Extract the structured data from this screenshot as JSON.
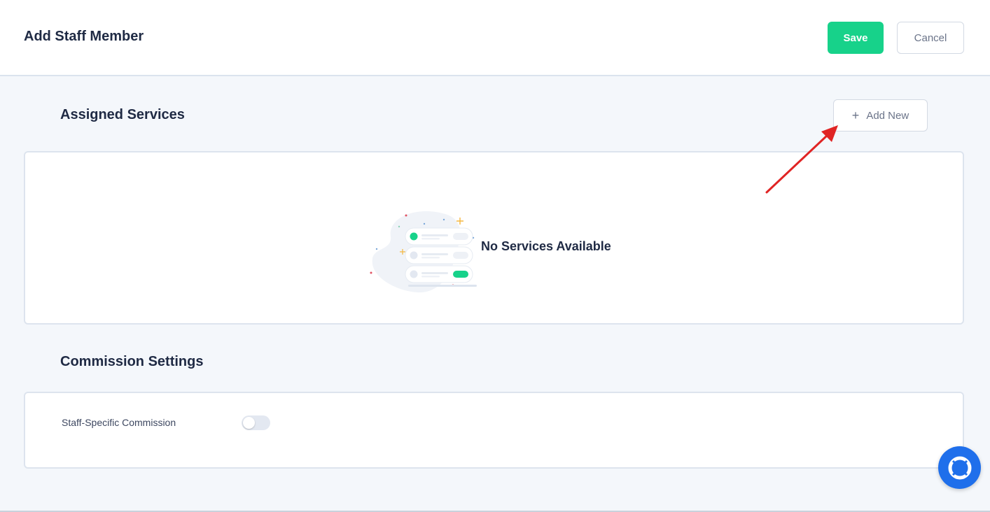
{
  "header": {
    "title": "Add Staff Member",
    "save_label": "Save",
    "cancel_label": "Cancel"
  },
  "assigned_services": {
    "title": "Assigned Services",
    "add_new_label": "Add New",
    "empty_message": "No Services Available"
  },
  "commission_settings": {
    "title": "Commission Settings",
    "staff_specific_label": "Staff-Specific Commission",
    "staff_specific_enabled": false
  },
  "colors": {
    "accent_green": "#17d28a",
    "annotation_red": "#e02424",
    "help_blue": "#1f6feb"
  },
  "icons": {
    "add": "plus-icon",
    "help": "lifebuoy-icon",
    "annotation": "arrow-annotation"
  }
}
